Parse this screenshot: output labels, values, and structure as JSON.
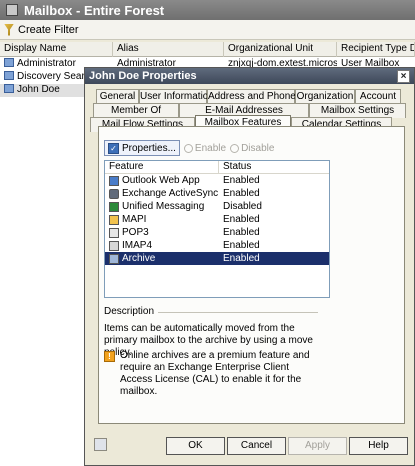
{
  "console": {
    "title": "Mailbox - Entire Forest",
    "create_filter": "Create Filter",
    "columns": [
      "Display Name",
      "Alias",
      "Organizational Unit",
      "Recipient Type Deta"
    ],
    "rows": [
      {
        "name": "Administrator",
        "alias": "Administrator",
        "ou": "znjxqj-dom.extest.micros...",
        "type": "User Mailbox"
      },
      {
        "name": "Discovery Search",
        "alias": "",
        "ou": "",
        "type": ""
      },
      {
        "name": "John Doe",
        "alias": "",
        "ou": "",
        "type": ""
      }
    ]
  },
  "dialog": {
    "title": "John Doe Properties",
    "close": "×",
    "tabs_row1": [
      "General",
      "User Information",
      "Address and Phone",
      "Organization",
      "Account"
    ],
    "tabs_row2": [
      "Member Of",
      "E-Mail Addresses",
      "Mailbox Settings"
    ],
    "tabs_row3": [
      "Mail Flow Settings",
      "Mailbox Features",
      "Calendar Settings"
    ],
    "active_tab": "Mailbox Features",
    "toolbar": {
      "properties": "Properties...",
      "enable": "Enable",
      "disable": "Disable"
    },
    "list_headers": {
      "feature": "Feature",
      "status": "Status"
    },
    "features": [
      {
        "name": "Outlook Web App",
        "status": "Enabled",
        "icon": "owa-icon"
      },
      {
        "name": "Exchange ActiveSync",
        "status": "Enabled",
        "icon": "activesync-icon"
      },
      {
        "name": "Unified Messaging",
        "status": "Disabled",
        "icon": "unified-messaging-icon"
      },
      {
        "name": "MAPI",
        "status": "Enabled",
        "icon": "mapi-icon"
      },
      {
        "name": "POP3",
        "status": "Enabled",
        "icon": "pop3-icon"
      },
      {
        "name": "IMAP4",
        "status": "Enabled",
        "icon": "imap4-icon"
      },
      {
        "name": "Archive",
        "status": "Enabled",
        "icon": "archive-icon"
      }
    ],
    "description_label": "Description",
    "description": "Items can be automatically moved from the primary mailbox to the archive by using a move policy.",
    "warning": "Online archives are a premium feature and require an Exchange Enterprise Client Access License (CAL) to enable it for the mailbox.",
    "buttons": {
      "ok": "OK",
      "cancel": "Cancel",
      "apply": "Apply",
      "help": "Help"
    }
  }
}
